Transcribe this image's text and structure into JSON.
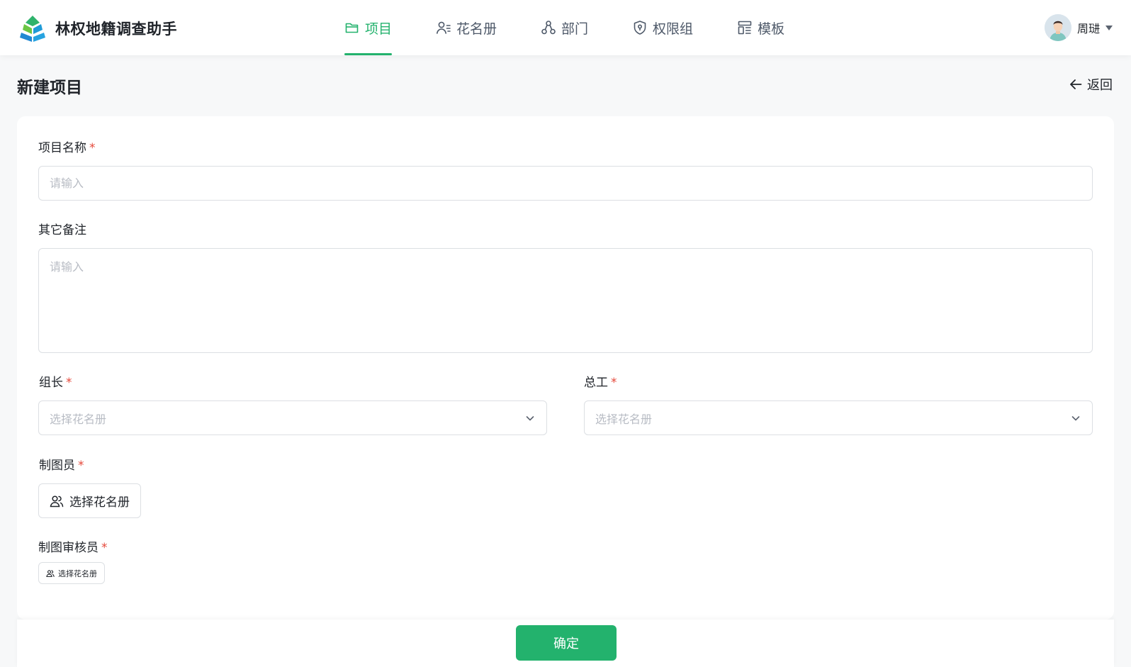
{
  "app": {
    "name": "林权地籍调查助手"
  },
  "nav": {
    "items": [
      {
        "label": "项目",
        "icon": "folder-icon",
        "active": true
      },
      {
        "label": "花名册",
        "icon": "user-list-icon",
        "active": false
      },
      {
        "label": "部门",
        "icon": "org-chart-icon",
        "active": false
      },
      {
        "label": "权限组",
        "icon": "shield-icon",
        "active": false
      },
      {
        "label": "模板",
        "icon": "template-icon",
        "active": false
      }
    ]
  },
  "user": {
    "name": "周琎"
  },
  "page": {
    "title": "新建项目",
    "back_label": "返回"
  },
  "form": {
    "project_name": {
      "label": "项目名称",
      "required": "*",
      "placeholder": "请输入",
      "value": ""
    },
    "remarks": {
      "label": "其它备注",
      "placeholder": "请输入",
      "value": ""
    },
    "leader": {
      "label": "组长",
      "required": "*",
      "placeholder": "选择花名册"
    },
    "chief_engineer": {
      "label": "总工",
      "required": "*",
      "placeholder": "选择花名册"
    },
    "drafter": {
      "label": "制图员",
      "required": "*",
      "button_label": "选择花名册"
    },
    "draft_reviewer": {
      "label": "制图审核员",
      "required": "*",
      "button_label": "选择花名册"
    }
  },
  "footer": {
    "confirm_label": "确定"
  },
  "colors": {
    "accent": "#23b26d",
    "required": "#e5483a",
    "border": "#dcdfe3",
    "placeholder": "#b8bcc4"
  }
}
